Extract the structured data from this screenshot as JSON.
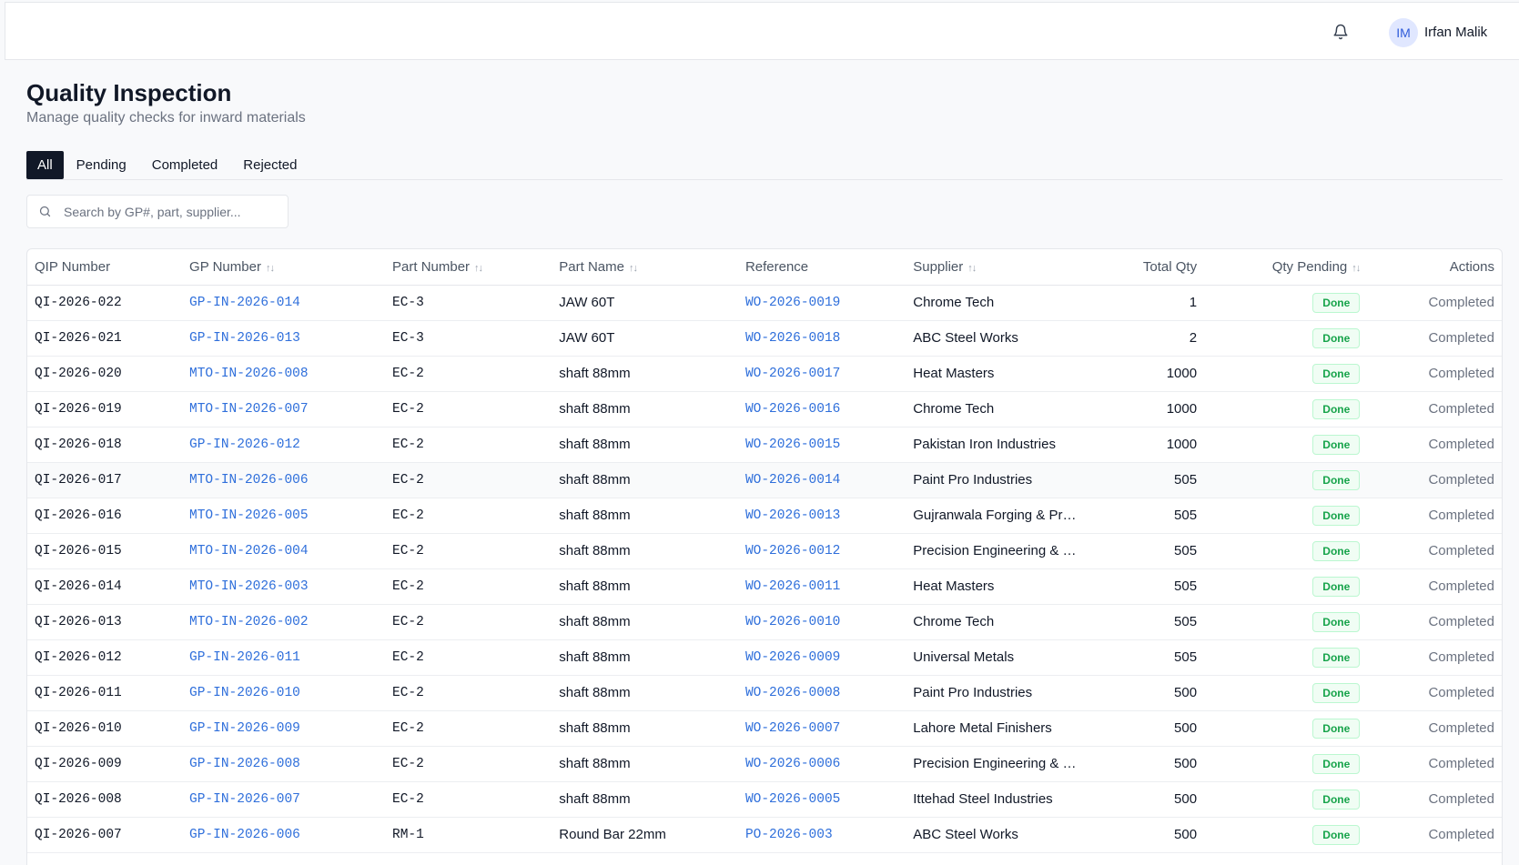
{
  "header": {
    "user_initials": "IM",
    "user_name": "Irfan Malik",
    "bell_icon": "bell-icon"
  },
  "page": {
    "title": "Quality Inspection",
    "subtitle": "Manage quality checks for inward materials"
  },
  "tabs": [
    {
      "label": "All",
      "active": true
    },
    {
      "label": "Pending",
      "active": false
    },
    {
      "label": "Completed",
      "active": false
    },
    {
      "label": "Rejected",
      "active": false
    }
  ],
  "search": {
    "placeholder": "Search by GP#, part, supplier...",
    "icon": "search-icon"
  },
  "table": {
    "columns": [
      "QIP Number",
      "GP Number",
      "Part Number",
      "Part Name",
      "Reference",
      "Supplier",
      "Total Qty",
      "Qty Pending",
      "Actions"
    ],
    "rows": [
      {
        "qip": "QI-2026-022",
        "gp": "GP-IN-2026-014",
        "part_no": "EC-3",
        "part_name": "JAW 60T",
        "ref": "WO-2026-0019",
        "supplier": "Chrome Tech",
        "total": "1",
        "pending": "Done",
        "action": "Completed"
      },
      {
        "qip": "QI-2026-021",
        "gp": "GP-IN-2026-013",
        "part_no": "EC-3",
        "part_name": "JAW 60T",
        "ref": "WO-2026-0018",
        "supplier": "ABC Steel Works",
        "total": "2",
        "pending": "Done",
        "action": "Completed"
      },
      {
        "qip": "QI-2026-020",
        "gp": "MTO-IN-2026-008",
        "part_no": "EC-2",
        "part_name": "shaft 88mm",
        "ref": "WO-2026-0017",
        "supplier": "Heat Masters",
        "total": "1000",
        "pending": "Done",
        "action": "Completed"
      },
      {
        "qip": "QI-2026-019",
        "gp": "MTO-IN-2026-007",
        "part_no": "EC-2",
        "part_name": "shaft 88mm",
        "ref": "WO-2026-0016",
        "supplier": "Chrome Tech",
        "total": "1000",
        "pending": "Done",
        "action": "Completed"
      },
      {
        "qip": "QI-2026-018",
        "gp": "GP-IN-2026-012",
        "part_no": "EC-2",
        "part_name": "shaft 88mm",
        "ref": "WO-2026-0015",
        "supplier": "Pakistan Iron Industries",
        "total": "1000",
        "pending": "Done",
        "action": "Completed"
      },
      {
        "qip": "QI-2026-017",
        "gp": "MTO-IN-2026-006",
        "part_no": "EC-2",
        "part_name": "shaft 88mm",
        "ref": "WO-2026-0014",
        "supplier": "Paint Pro Industries",
        "total": "505",
        "pending": "Done",
        "action": "Completed"
      },
      {
        "qip": "QI-2026-016",
        "gp": "MTO-IN-2026-005",
        "part_no": "EC-2",
        "part_name": "shaft 88mm",
        "ref": "WO-2026-0013",
        "supplier": "Gujranwala Forging & Processi...",
        "total": "505",
        "pending": "Done",
        "action": "Completed"
      },
      {
        "qip": "QI-2026-015",
        "gp": "MTO-IN-2026-004",
        "part_no": "EC-2",
        "part_name": "shaft 88mm",
        "ref": "WO-2026-0012",
        "supplier": "Precision Engineering & HT Se...",
        "total": "505",
        "pending": "Done",
        "action": "Completed"
      },
      {
        "qip": "QI-2026-014",
        "gp": "MTO-IN-2026-003",
        "part_no": "EC-2",
        "part_name": "shaft 88mm",
        "ref": "WO-2026-0011",
        "supplier": "Heat Masters",
        "total": "505",
        "pending": "Done",
        "action": "Completed"
      },
      {
        "qip": "QI-2026-013",
        "gp": "MTO-IN-2026-002",
        "part_no": "EC-2",
        "part_name": "shaft 88mm",
        "ref": "WO-2026-0010",
        "supplier": "Chrome Tech",
        "total": "505",
        "pending": "Done",
        "action": "Completed"
      },
      {
        "qip": "QI-2026-012",
        "gp": "GP-IN-2026-011",
        "part_no": "EC-2",
        "part_name": "shaft 88mm",
        "ref": "WO-2026-0009",
        "supplier": "Universal Metals",
        "total": "505",
        "pending": "Done",
        "action": "Completed"
      },
      {
        "qip": "QI-2026-011",
        "gp": "GP-IN-2026-010",
        "part_no": "EC-2",
        "part_name": "shaft 88mm",
        "ref": "WO-2026-0008",
        "supplier": "Paint Pro Industries",
        "total": "500",
        "pending": "Done",
        "action": "Completed"
      },
      {
        "qip": "QI-2026-010",
        "gp": "GP-IN-2026-009",
        "part_no": "EC-2",
        "part_name": "shaft 88mm",
        "ref": "WO-2026-0007",
        "supplier": "Lahore Metal Finishers",
        "total": "500",
        "pending": "Done",
        "action": "Completed"
      },
      {
        "qip": "QI-2026-009",
        "gp": "GP-IN-2026-008",
        "part_no": "EC-2",
        "part_name": "shaft 88mm",
        "ref": "WO-2026-0006",
        "supplier": "Precision Engineering & HT Se...",
        "total": "500",
        "pending": "Done",
        "action": "Completed"
      },
      {
        "qip": "QI-2026-008",
        "gp": "GP-IN-2026-007",
        "part_no": "EC-2",
        "part_name": "shaft 88mm",
        "ref": "WO-2026-0005",
        "supplier": "Ittehad Steel Industries",
        "total": "500",
        "pending": "Done",
        "action": "Completed"
      },
      {
        "qip": "QI-2026-007",
        "gp": "GP-IN-2026-006",
        "part_no": "RM-1",
        "part_name": "Round Bar 22mm",
        "ref": "PO-2026-003",
        "supplier": "ABC Steel Works",
        "total": "500",
        "pending": "Done",
        "action": "Completed"
      }
    ]
  },
  "colors": {
    "link": "#2f6fdb",
    "badge_green": "#16a34a",
    "active_tab": "#111827"
  }
}
